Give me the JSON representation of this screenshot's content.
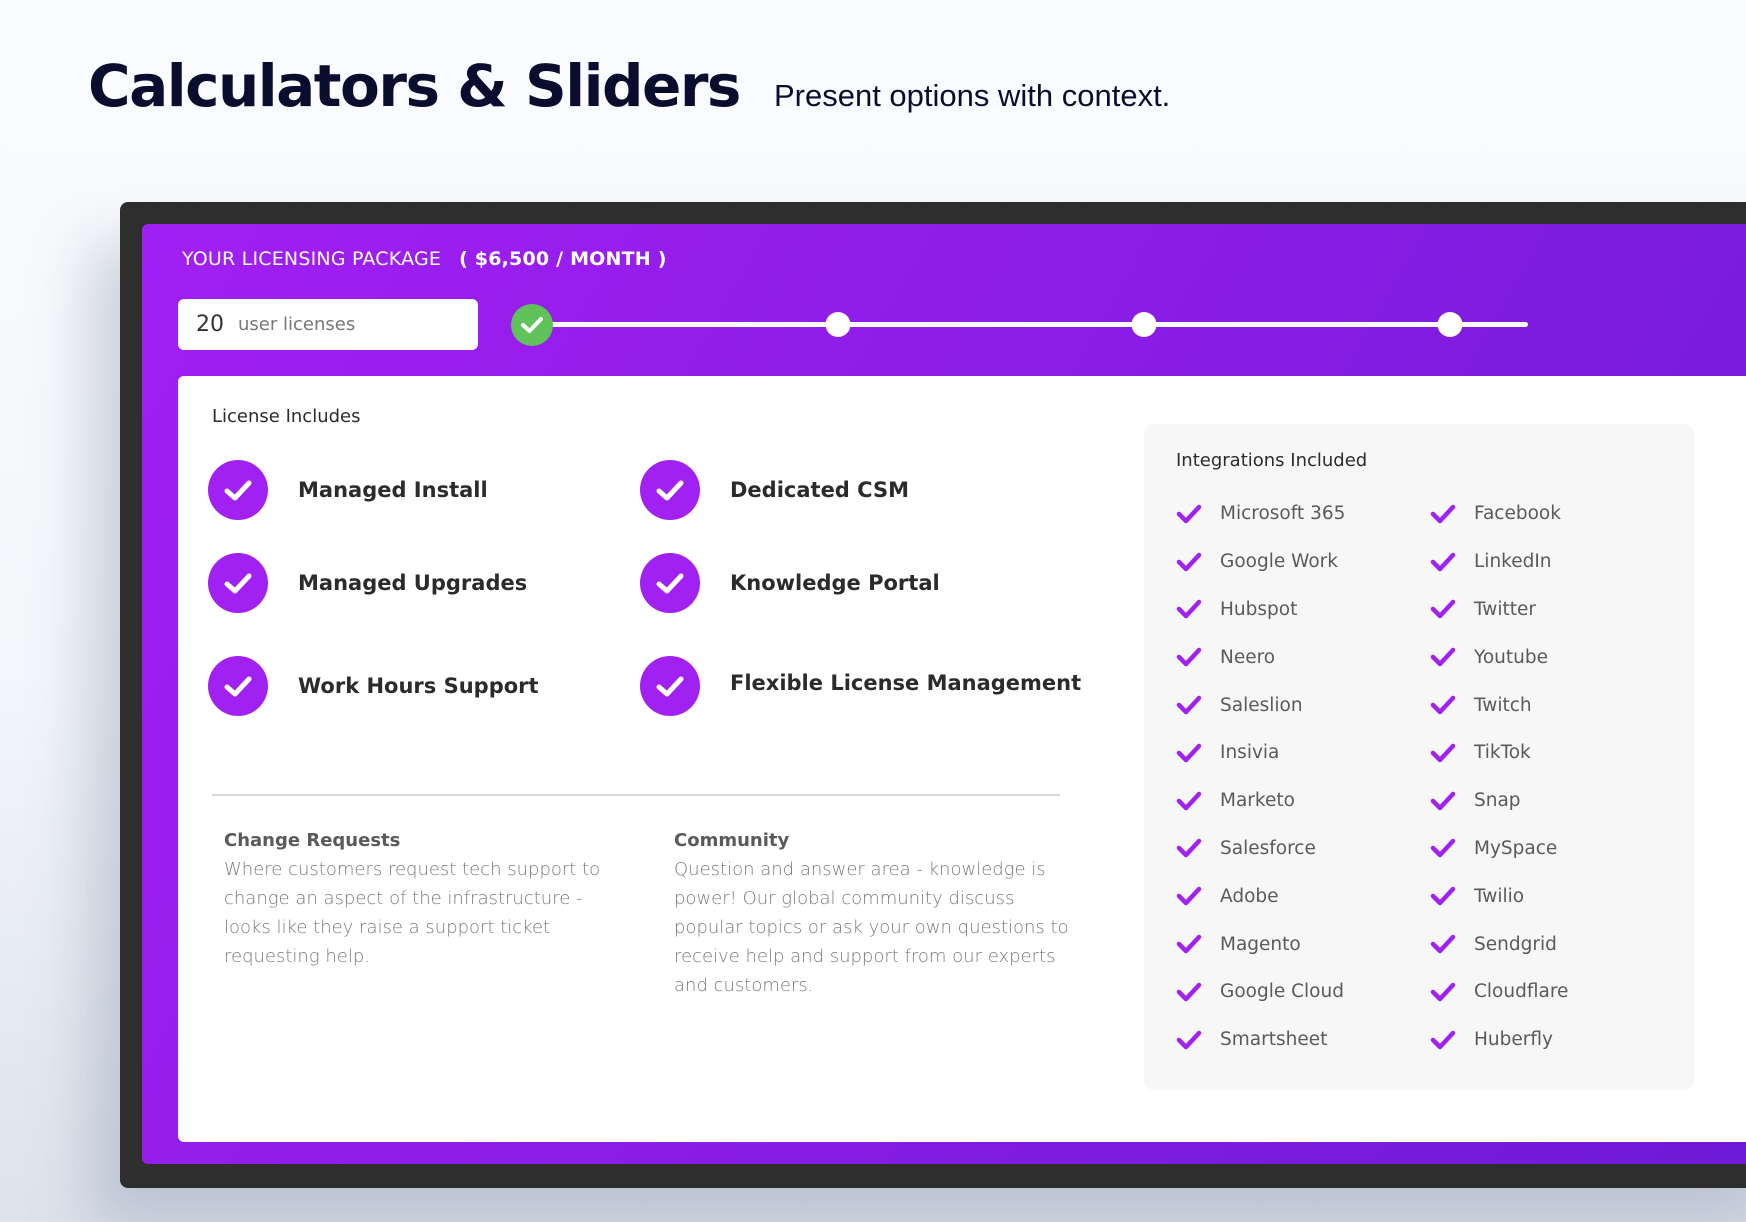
{
  "header": {
    "title": "Calculators & Sliders",
    "subtitle": "Present options with context."
  },
  "package": {
    "title": "YOUR LICENSING PACKAGE",
    "price": "( $6,500 / MONTH )",
    "license_count": "20",
    "license_unit": "user licenses",
    "slider": {
      "stops": 4,
      "selected_index": 0,
      "handle_color": "#5fc25a",
      "handle_icon": "check-icon"
    }
  },
  "colors": {
    "accent": "#a021f2",
    "gradient_start": "#a21ff4",
    "gradient_end": "#6c1ad4",
    "success": "#5fc25a",
    "frame": "#2e2e2e",
    "title": "#0b0d2e"
  },
  "license_includes": {
    "label": "License Includes",
    "features": [
      {
        "label": "Managed Install",
        "icon": "check-circle-icon"
      },
      {
        "label": "Managed Upgrades",
        "icon": "check-circle-icon"
      },
      {
        "label": "Work Hours Support",
        "icon": "check-circle-icon"
      },
      {
        "label": "Dedicated CSM",
        "icon": "check-circle-icon"
      },
      {
        "label": "Knowledge Portal",
        "icon": "check-circle-icon"
      },
      {
        "label": "Flexible License Management",
        "icon": "check-circle-icon"
      }
    ]
  },
  "info": [
    {
      "title": "Change Requests",
      "text": "Where customers request tech support to change an aspect of the infrastructure - looks like they raise a support ticket requesting help."
    },
    {
      "title": "Community",
      "text": "Question and answer area - knowledge is power! Our global community discuss popular topics or ask your own questions to receive help and support from our experts and customers."
    }
  ],
  "integrations": {
    "title": "Integrations Included",
    "left": [
      "Microsoft 365",
      "Google Work",
      "Hubspot",
      "Neero",
      "Saleslion",
      "Insivia",
      "Marketo",
      "Salesforce",
      "Adobe",
      "Magento",
      "Google Cloud",
      "Smartsheet"
    ],
    "right": [
      "Facebook",
      "LinkedIn",
      "Twitter",
      "Youtube",
      "Twitch",
      "TikTok",
      "Snap",
      "MySpace",
      "Twilio",
      "Sendgrid",
      "Cloudflare",
      "Huberfly"
    ]
  }
}
